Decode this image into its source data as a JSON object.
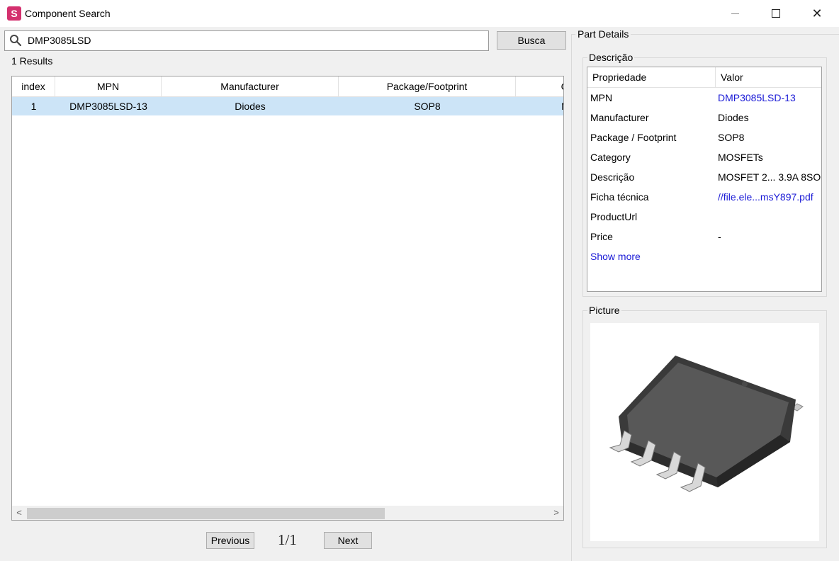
{
  "window": {
    "app_icon_letter": "S",
    "title": "Component Search",
    "close_glyph": "✕"
  },
  "search": {
    "value": "DMP3085LSD",
    "button_label": "Busca"
  },
  "results": {
    "count_text": "1 Results",
    "columns": [
      "index",
      "MPN",
      "Manufacturer",
      "Package/Footprint",
      "Cat"
    ],
    "rows": [
      {
        "index": "1",
        "mpn": "DMP3085LSD-13",
        "manufacturer": "Diodes",
        "package": "SOP8",
        "category": "MC"
      }
    ],
    "scroll_left_glyph": "<",
    "scroll_right_glyph": ">"
  },
  "pagination": {
    "previous_label": "Previous",
    "page_text": "1/1",
    "next_label": "Next"
  },
  "part_details": {
    "title": "Part Details",
    "description_group_title": "Descrição",
    "headers": {
      "property": "Propriedade",
      "value": "Valor"
    },
    "properties": [
      {
        "key": "MPN",
        "value": "DMP3085LSD-13",
        "is_link": true
      },
      {
        "key": "Manufacturer",
        "value": "Diodes",
        "is_link": false
      },
      {
        "key": "Package / Footprint",
        "value": "SOP8",
        "is_link": false
      },
      {
        "key": "Category",
        "value": "MOSFETs",
        "is_link": false
      },
      {
        "key": "Descrição",
        "value": "MOSFET 2... 3.9A 8SO",
        "is_link": false
      },
      {
        "key": "Ficha técnica",
        "value": "//file.ele...msY897.pdf",
        "is_link": true
      },
      {
        "key": "ProductUrl",
        "value": "",
        "is_link": false
      },
      {
        "key": "Price",
        "value": "-",
        "is_link": false
      }
    ],
    "show_more_label": "Show more",
    "picture_group_title": "Picture"
  },
  "colors": {
    "selected_row": "#cce4f7",
    "link": "#1a1ad6",
    "app_icon": "#d4306e"
  },
  "icons": [
    "search-icon",
    "minimize-icon",
    "maximize-icon",
    "close-icon",
    "chip-image"
  ]
}
